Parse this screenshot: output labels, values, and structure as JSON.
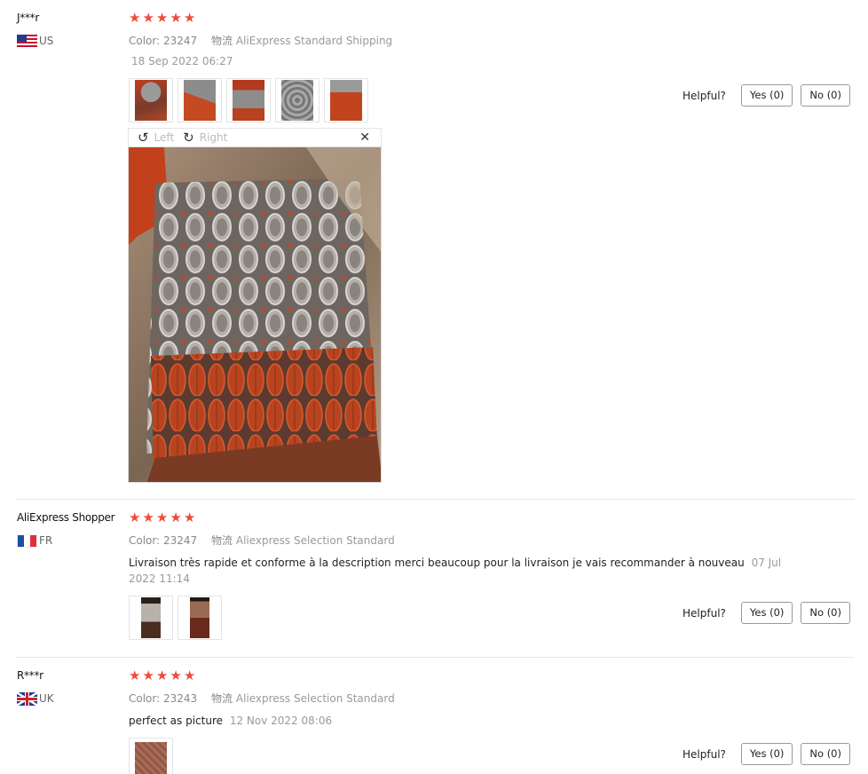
{
  "colors": {
    "star": "#ef4a3c",
    "divider": "#e8e8e8"
  },
  "helpful_label": "Helpful?",
  "reviews": [
    {
      "user": "J***r",
      "country": "US",
      "rating": 5,
      "color_label": "Color:",
      "color_value": "23247",
      "shipping_label": "物流",
      "shipping_value": "AliExpress Standard Shipping",
      "date": "18 Sep 2022 06:27",
      "text": "",
      "photo_count": 5,
      "yes": "Yes (0)",
      "no": "No (0)",
      "viewer": {
        "left": "Left",
        "right": "Right",
        "close": "✕"
      }
    },
    {
      "user": "AliExpress Shopper",
      "country": "FR",
      "rating": 5,
      "color_label": "Color:",
      "color_value": "23247",
      "shipping_label": "物流",
      "shipping_value": "Aliexpress Selection Standard",
      "text": "Livraison très rapide et conforme à la description merci beaucoup pour la livraison je vais recommander à nouveau",
      "date_a": "07 Jul",
      "date_b": "2022 11:14",
      "photo_count": 2,
      "yes": "Yes (0)",
      "no": "No (0)"
    },
    {
      "user": "R***r",
      "country": "UK",
      "rating": 5,
      "color_label": "Color:",
      "color_value": "23243",
      "shipping_label": "物流",
      "shipping_value": "Aliexpress Selection Standard",
      "text": "perfect as picture",
      "date": "12 Nov 2022 08:06",
      "photo_count": 1,
      "yes": "Yes (0)",
      "no": "No (0)"
    }
  ],
  "icons": {
    "star": "star-icon",
    "rotate_left": "rotate-left-icon",
    "rotate_right": "rotate-right-icon",
    "close": "close-icon"
  }
}
